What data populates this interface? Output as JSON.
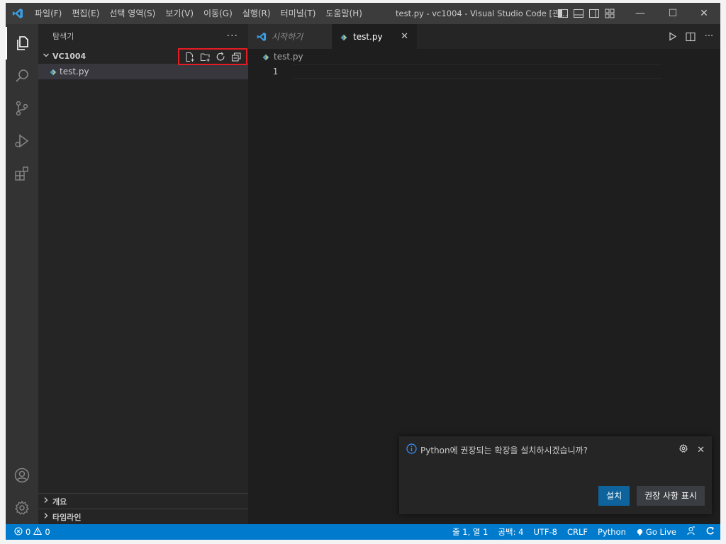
{
  "titlebar": {
    "menu": [
      "파일(F)",
      "편집(E)",
      "선택 영역(S)",
      "보기(V)",
      "이동(G)",
      "실행(R)",
      "터미널(T)",
      "도움말(H)"
    ],
    "title": "test.py - vc1004 - Visual Studio Code [관...",
    "minimize": "—",
    "maximize": "☐",
    "close": "✕"
  },
  "sidebar": {
    "title": "탐색기",
    "more": "···",
    "folder": "VC1004",
    "files": [
      "test.py"
    ],
    "sections": [
      "개요",
      "타임라인"
    ]
  },
  "editor": {
    "tabs": [
      {
        "label": "시작하기",
        "active": false
      },
      {
        "label": "test.py",
        "active": true
      }
    ],
    "breadcrumb": "test.py",
    "lines": [
      "1"
    ]
  },
  "notification": {
    "message": "Python에 권장되는 확장을 설치하시겠습니까?",
    "install": "설치",
    "show_recommendations": "권장 사항 표시"
  },
  "statusbar": {
    "errors": "0",
    "warnings": "0",
    "position": "줄 1, 열 1",
    "spaces": "공백: 4",
    "encoding": "UTF-8",
    "eol": "CRLF",
    "language": "Python",
    "golive": "Go Live"
  },
  "colors": {
    "accent": "#007acc",
    "highlight_box": "#e51c23",
    "python_icon": "#519aba"
  }
}
